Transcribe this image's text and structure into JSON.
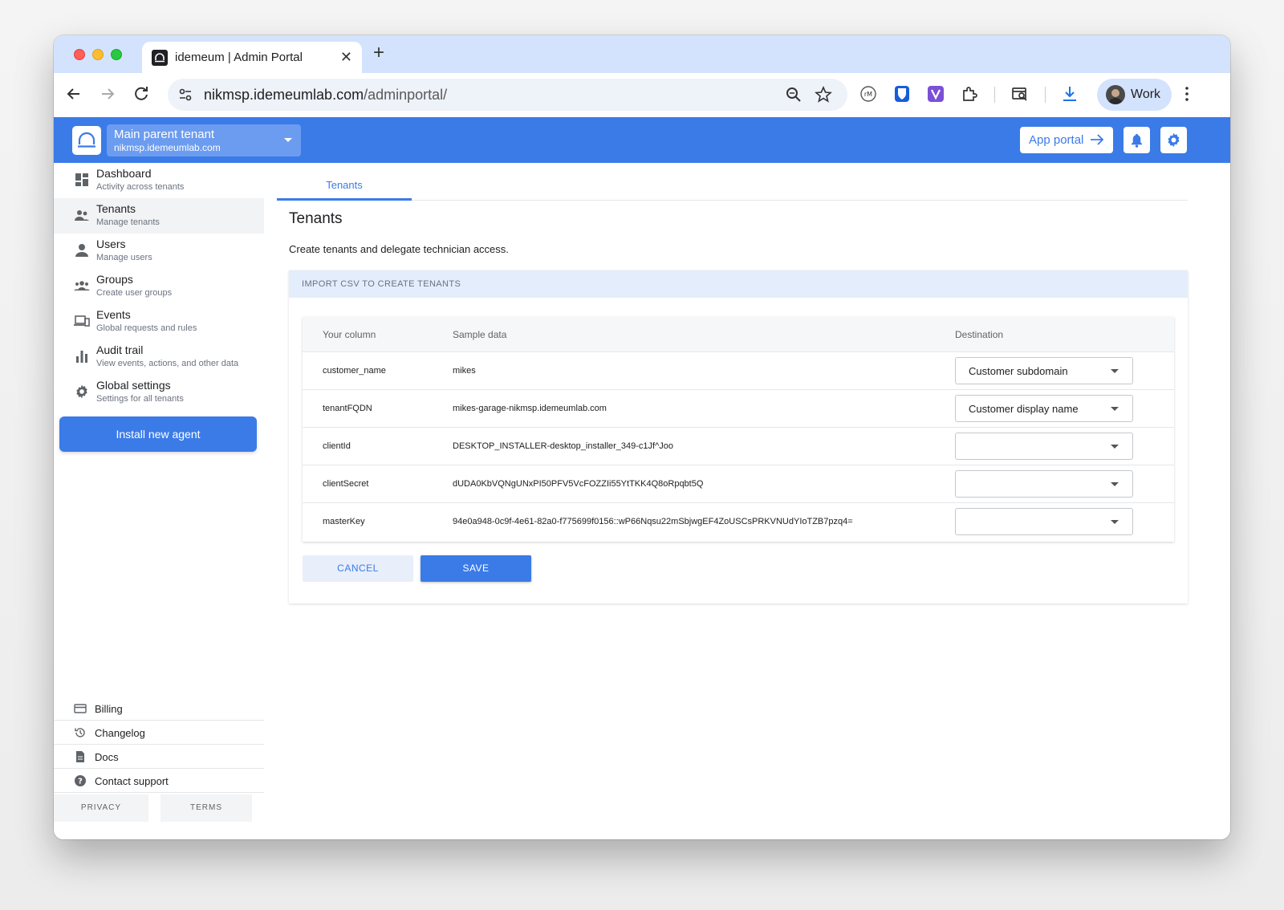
{
  "browser": {
    "tab_title": "idemeum | Admin Portal",
    "url_host": "nikmsp.idemeumlab.com",
    "url_path": "/adminportal/",
    "profile_label": "Work"
  },
  "header": {
    "tenant_name": "Main parent tenant",
    "tenant_domain": "nikmsp.idemeumlab.com",
    "app_portal_label": "App portal"
  },
  "sidebar": {
    "items": [
      {
        "label": "Dashboard",
        "sub": "Activity across tenants",
        "icon": "dashboard-icon"
      },
      {
        "label": "Tenants",
        "sub": "Manage tenants",
        "icon": "tenants-icon"
      },
      {
        "label": "Users",
        "sub": "Manage users",
        "icon": "user-icon"
      },
      {
        "label": "Groups",
        "sub": "Create user groups",
        "icon": "groups-icon"
      },
      {
        "label": "Events",
        "sub": "Global requests and rules",
        "icon": "devices-icon"
      },
      {
        "label": "Audit trail",
        "sub": "View events, actions, and other data",
        "icon": "bar-chart-icon"
      },
      {
        "label": "Global settings",
        "sub": "Settings for all tenants",
        "icon": "gear-icon"
      }
    ],
    "install_label": "Install new agent",
    "footer": [
      {
        "label": "Billing",
        "icon": "credit-card-icon"
      },
      {
        "label": "Changelog",
        "icon": "history-icon"
      },
      {
        "label": "Docs",
        "icon": "document-icon"
      },
      {
        "label": "Contact support",
        "icon": "help-icon"
      }
    ],
    "privacy_label": "PRIVACY",
    "terms_label": "TERMS"
  },
  "main": {
    "tab_label": "Tenants",
    "title": "Tenants",
    "description": "Create tenants and delegate technician access.",
    "card_header": "IMPORT CSV TO CREATE TENANTS",
    "table": {
      "columns": [
        "Your column",
        "Sample data",
        "Destination"
      ],
      "rows": [
        {
          "column": "customer_name",
          "sample": "mikes",
          "destination": "Customer subdomain"
        },
        {
          "column": "tenantFQDN",
          "sample": "mikes-garage-nikmsp.idemeumlab.com",
          "destination": "Customer display name"
        },
        {
          "column": "clientId",
          "sample": "DESKTOP_INSTALLER-desktop_installer_349-c1Jf^Joo",
          "destination": ""
        },
        {
          "column": "clientSecret",
          "sample": "dUDA0KbVQNgUNxPI50PFV5VcFOZZIi55YtTKK4Q8oRpqbt5Q",
          "destination": ""
        },
        {
          "column": "masterKey",
          "sample": "94e0a948-0c9f-4e61-82a0-f775699f0156::wP66Nqsu22mSbjwgEF4ZoUSCsPRKVNUdYIoTZB7pzq4=",
          "destination": ""
        }
      ]
    },
    "cancel_label": "CANCEL",
    "save_label": "SAVE"
  },
  "colors": {
    "brand": "#3b7be8",
    "tabstrip": "#d3e3fd",
    "card_header": "#e4edfb"
  }
}
